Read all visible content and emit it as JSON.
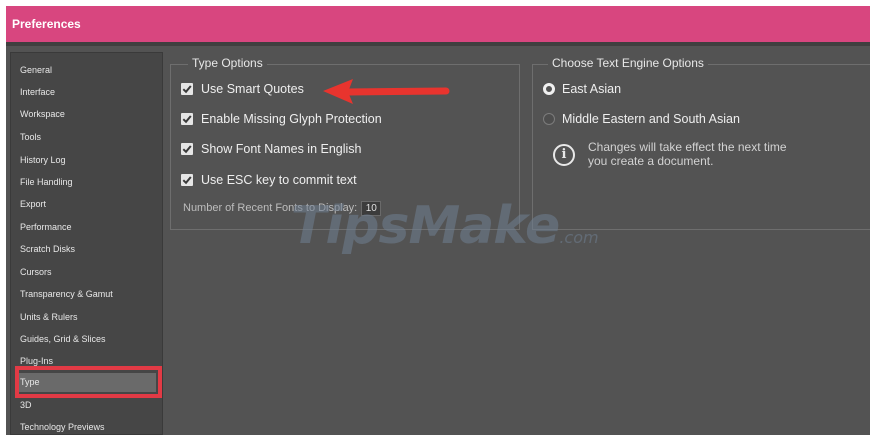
{
  "window": {
    "title": "Preferences"
  },
  "sidebar": {
    "items": [
      {
        "label": "General"
      },
      {
        "label": "Interface"
      },
      {
        "label": "Workspace"
      },
      {
        "label": "Tools"
      },
      {
        "label": "History Log"
      },
      {
        "label": "File Handling"
      },
      {
        "label": "Export"
      },
      {
        "label": "Performance"
      },
      {
        "label": "Scratch Disks"
      },
      {
        "label": "Cursors"
      },
      {
        "label": "Transparency & Gamut"
      },
      {
        "label": "Units & Rulers"
      },
      {
        "label": "Guides, Grid & Slices"
      },
      {
        "label": "Plug-Ins"
      },
      {
        "label": "Type"
      },
      {
        "label": "3D"
      },
      {
        "label": "Technology Previews"
      }
    ],
    "selected": "Type"
  },
  "type_options": {
    "title": "Type Options",
    "checkboxes": [
      {
        "label": "Use Smart Quotes",
        "checked": true
      },
      {
        "label": "Enable Missing Glyph Protection",
        "checked": true
      },
      {
        "label": "Show Font Names in English",
        "checked": true
      },
      {
        "label": "Use ESC key to commit text",
        "checked": true
      }
    ],
    "recent_fonts": {
      "label": "Number of Recent Fonts to Display:",
      "value": "10"
    }
  },
  "text_engine": {
    "title": "Choose Text Engine Options",
    "radios": [
      {
        "label": "East Asian",
        "selected": true
      },
      {
        "label": "Middle Eastern and South Asian",
        "selected": false
      }
    ],
    "info_line1": "Changes will take effect the next time",
    "info_line2": "you create a document."
  },
  "watermark": {
    "text": "TipsMake",
    "suffix": ".com"
  },
  "colors": {
    "titlebar": "#d8467f",
    "panel": "#535353",
    "sidebar": "#464646",
    "highlight": "#e23a45"
  },
  "icons": [
    "checkmark-icon",
    "info-icon",
    "red-arrow-annotation"
  ]
}
